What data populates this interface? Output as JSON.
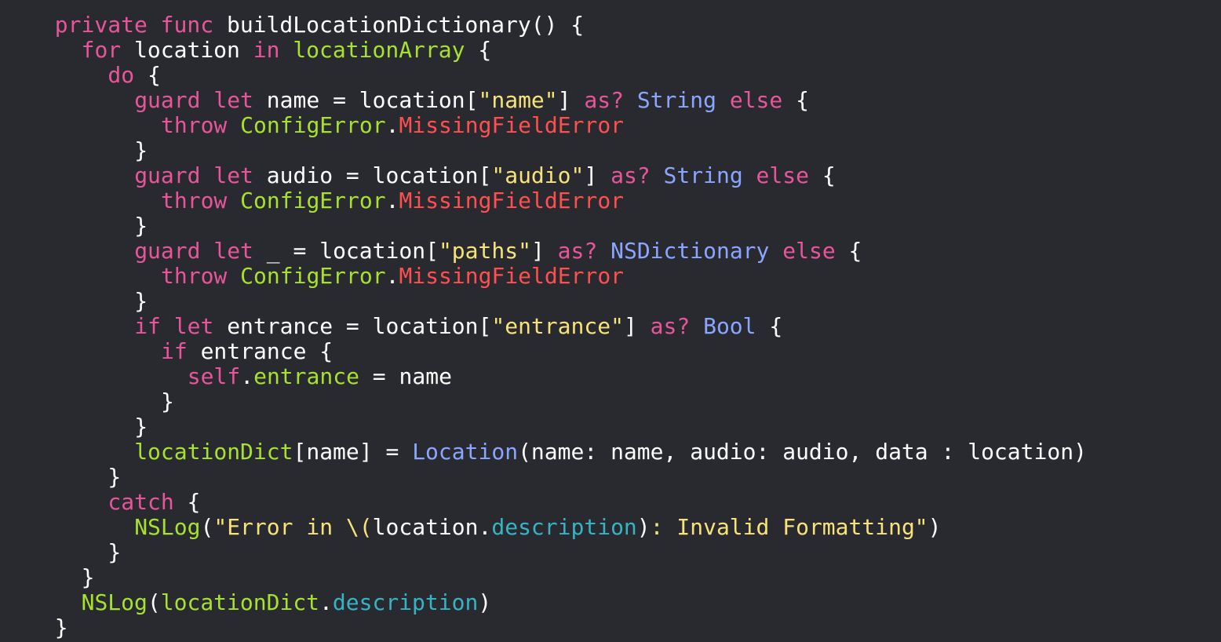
{
  "colors": {
    "background": "#292a30",
    "plain": "#ffffff",
    "keyword": "#fc5fa3",
    "project": "#9ef1dd",
    "function": "#67b7a4",
    "type": "#a167e6",
    "string": "#fc6a5d",
    "sdk_type": "#5dd8ff",
    "method": "#d0a8ff"
  },
  "code": {
    "lines": [
      {
        "indent": 2,
        "tokens": [
          {
            "t": "private",
            "c": "#e9559c"
          },
          {
            "t": " ",
            "c": "#ffffff"
          },
          {
            "t": "func",
            "c": "#e9559c"
          },
          {
            "t": " buildLocationDictionary() {",
            "c": "#ffffff"
          }
        ]
      },
      {
        "indent": 4,
        "tokens": [
          {
            "t": "for",
            "c": "#e9559c"
          },
          {
            "t": " location ",
            "c": "#ffffff"
          },
          {
            "t": "in",
            "c": "#e9559c"
          },
          {
            "t": " ",
            "c": "#ffffff"
          },
          {
            "t": "locationArray",
            "c": "#a6e22e"
          },
          {
            "t": " {",
            "c": "#ffffff"
          }
        ]
      },
      {
        "indent": 6,
        "tokens": [
          {
            "t": "do",
            "c": "#e9559c"
          },
          {
            "t": " {",
            "c": "#ffffff"
          }
        ]
      },
      {
        "indent": 8,
        "tokens": [
          {
            "t": "guard",
            "c": "#e9559c"
          },
          {
            "t": " ",
            "c": "#ffffff"
          },
          {
            "t": "let",
            "c": "#e9559c"
          },
          {
            "t": " name = location[",
            "c": "#ffffff"
          },
          {
            "t": "\"name\"",
            "c": "#f8e37a"
          },
          {
            "t": "] ",
            "c": "#ffffff"
          },
          {
            "t": "as?",
            "c": "#e9559c"
          },
          {
            "t": " ",
            "c": "#ffffff"
          },
          {
            "t": "String",
            "c": "#8aa6ff"
          },
          {
            "t": " ",
            "c": "#ffffff"
          },
          {
            "t": "else",
            "c": "#e9559c"
          },
          {
            "t": " {",
            "c": "#ffffff"
          }
        ]
      },
      {
        "indent": 10,
        "tokens": [
          {
            "t": "throw",
            "c": "#e9559c"
          },
          {
            "t": " ",
            "c": "#ffffff"
          },
          {
            "t": "ConfigError",
            "c": "#a6e22e"
          },
          {
            "t": ".",
            "c": "#ffffff"
          },
          {
            "t": "MissingFieldError",
            "c": "#ff4f4f"
          }
        ]
      },
      {
        "indent": 8,
        "tokens": [
          {
            "t": "}",
            "c": "#ffffff"
          }
        ]
      },
      {
        "indent": 8,
        "tokens": [
          {
            "t": "guard",
            "c": "#e9559c"
          },
          {
            "t": " ",
            "c": "#ffffff"
          },
          {
            "t": "let",
            "c": "#e9559c"
          },
          {
            "t": " audio = location[",
            "c": "#ffffff"
          },
          {
            "t": "\"audio\"",
            "c": "#f8e37a"
          },
          {
            "t": "] ",
            "c": "#ffffff"
          },
          {
            "t": "as?",
            "c": "#e9559c"
          },
          {
            "t": " ",
            "c": "#ffffff"
          },
          {
            "t": "String",
            "c": "#8aa6ff"
          },
          {
            "t": " ",
            "c": "#ffffff"
          },
          {
            "t": "else",
            "c": "#e9559c"
          },
          {
            "t": " {",
            "c": "#ffffff"
          }
        ]
      },
      {
        "indent": 10,
        "tokens": [
          {
            "t": "throw",
            "c": "#e9559c"
          },
          {
            "t": " ",
            "c": "#ffffff"
          },
          {
            "t": "ConfigError",
            "c": "#a6e22e"
          },
          {
            "t": ".",
            "c": "#ffffff"
          },
          {
            "t": "MissingFieldError",
            "c": "#ff4f4f"
          }
        ]
      },
      {
        "indent": 8,
        "tokens": [
          {
            "t": "}",
            "c": "#ffffff"
          }
        ]
      },
      {
        "indent": 8,
        "tokens": [
          {
            "t": "guard",
            "c": "#e9559c"
          },
          {
            "t": " ",
            "c": "#ffffff"
          },
          {
            "t": "let",
            "c": "#e9559c"
          },
          {
            "t": " _ = location[",
            "c": "#ffffff"
          },
          {
            "t": "\"paths\"",
            "c": "#f8e37a"
          },
          {
            "t": "] ",
            "c": "#ffffff"
          },
          {
            "t": "as?",
            "c": "#e9559c"
          },
          {
            "t": " ",
            "c": "#ffffff"
          },
          {
            "t": "NSDictionary",
            "c": "#8aa6ff"
          },
          {
            "t": " ",
            "c": "#ffffff"
          },
          {
            "t": "else",
            "c": "#e9559c"
          },
          {
            "t": " {",
            "c": "#ffffff"
          }
        ]
      },
      {
        "indent": 10,
        "tokens": [
          {
            "t": "throw",
            "c": "#e9559c"
          },
          {
            "t": " ",
            "c": "#ffffff"
          },
          {
            "t": "ConfigError",
            "c": "#a6e22e"
          },
          {
            "t": ".",
            "c": "#ffffff"
          },
          {
            "t": "MissingFieldError",
            "c": "#ff4f4f"
          }
        ]
      },
      {
        "indent": 8,
        "tokens": [
          {
            "t": "}",
            "c": "#ffffff"
          }
        ]
      },
      {
        "indent": 8,
        "tokens": [
          {
            "t": "if",
            "c": "#e9559c"
          },
          {
            "t": " ",
            "c": "#ffffff"
          },
          {
            "t": "let",
            "c": "#e9559c"
          },
          {
            "t": " entrance = location[",
            "c": "#ffffff"
          },
          {
            "t": "\"entrance\"",
            "c": "#f8e37a"
          },
          {
            "t": "] ",
            "c": "#ffffff"
          },
          {
            "t": "as?",
            "c": "#e9559c"
          },
          {
            "t": " ",
            "c": "#ffffff"
          },
          {
            "t": "Bool",
            "c": "#8aa6ff"
          },
          {
            "t": " {",
            "c": "#ffffff"
          }
        ]
      },
      {
        "indent": 10,
        "tokens": [
          {
            "t": "if",
            "c": "#e9559c"
          },
          {
            "t": " entrance {",
            "c": "#ffffff"
          }
        ]
      },
      {
        "indent": 12,
        "tokens": [
          {
            "t": "self",
            "c": "#e9559c"
          },
          {
            "t": ".",
            "c": "#ffffff"
          },
          {
            "t": "entrance",
            "c": "#a6e22e"
          },
          {
            "t": " = name",
            "c": "#ffffff"
          }
        ]
      },
      {
        "indent": 10,
        "tokens": [
          {
            "t": "}",
            "c": "#ffffff"
          }
        ]
      },
      {
        "indent": 8,
        "tokens": [
          {
            "t": "}",
            "c": "#ffffff"
          }
        ]
      },
      {
        "indent": 8,
        "tokens": [
          {
            "t": "locationDict",
            "c": "#a6e22e"
          },
          {
            "t": "[name] = ",
            "c": "#ffffff"
          },
          {
            "t": "Location",
            "c": "#8aa6ff"
          },
          {
            "t": "(name: name, audio: audio, data : location)",
            "c": "#ffffff"
          }
        ]
      },
      {
        "indent": 6,
        "tokens": [
          {
            "t": "}",
            "c": "#ffffff"
          }
        ]
      },
      {
        "indent": 6,
        "tokens": [
          {
            "t": "catch",
            "c": "#e9559c"
          },
          {
            "t": " {",
            "c": "#ffffff"
          }
        ]
      },
      {
        "indent": 8,
        "tokens": [
          {
            "t": "NSLog",
            "c": "#a6e22e"
          },
          {
            "t": "(",
            "c": "#ffffff"
          },
          {
            "t": "\"Error in \\(",
            "c": "#f8e37a"
          },
          {
            "t": "location.",
            "c": "#ffffff"
          },
          {
            "t": "description",
            "c": "#36b4c4"
          },
          {
            "t": ")",
            "c": "#ffffff"
          },
          {
            "t": ": Invalid Formatting\"",
            "c": "#f8e37a"
          },
          {
            "t": ")",
            "c": "#ffffff"
          }
        ]
      },
      {
        "indent": 6,
        "tokens": [
          {
            "t": "}",
            "c": "#ffffff"
          }
        ]
      },
      {
        "indent": 4,
        "tokens": [
          {
            "t": "}",
            "c": "#ffffff"
          }
        ]
      },
      {
        "indent": 4,
        "tokens": [
          {
            "t": "NSLog",
            "c": "#a6e22e"
          },
          {
            "t": "(",
            "c": "#ffffff"
          },
          {
            "t": "locationDict",
            "c": "#a6e22e"
          },
          {
            "t": ".",
            "c": "#ffffff"
          },
          {
            "t": "description",
            "c": "#36b4c4"
          },
          {
            "t": ")",
            "c": "#ffffff"
          }
        ]
      },
      {
        "indent": 2,
        "tokens": [
          {
            "t": "}",
            "c": "#ffffff"
          }
        ]
      }
    ]
  }
}
